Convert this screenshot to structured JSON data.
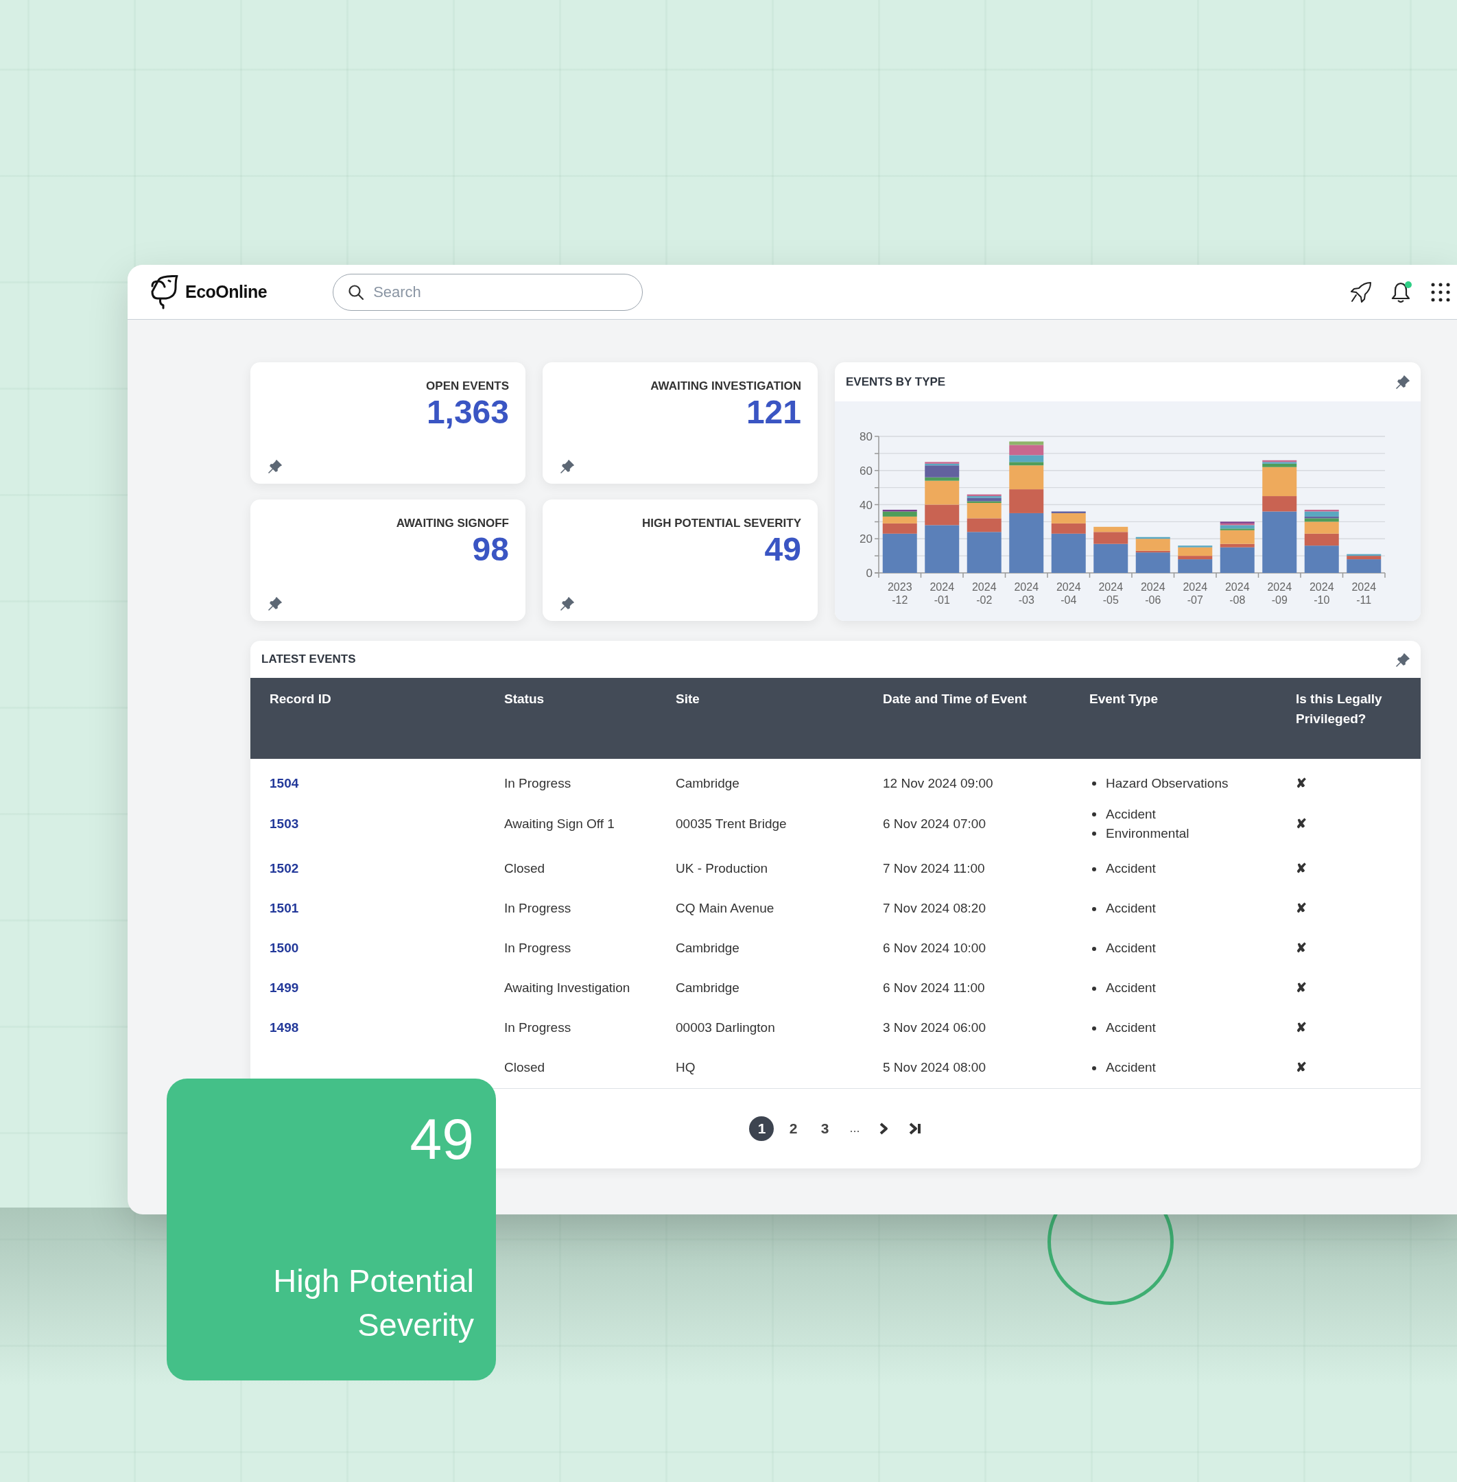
{
  "header": {
    "logo_text": "EcoOnline",
    "search": {
      "placeholder": "Search"
    },
    "has_notifications": true
  },
  "kpis": [
    {
      "title": "OPEN EVENTS",
      "value": "1,363"
    },
    {
      "title": "AWAITING INVESTIGATION",
      "value": "121"
    },
    {
      "title": "AWAITING SIGNOFF",
      "value": "98"
    },
    {
      "title": "HIGH POTENTIAL SEVERITY",
      "value": "49"
    }
  ],
  "events_by_type": {
    "title": "EVENTS BY TYPE",
    "chart_data": {
      "type": "bar",
      "stacked": true,
      "grid": true,
      "categories": [
        "2023-12",
        "2024-01",
        "2024-02",
        "2024-03",
        "2024-04",
        "2024-05",
        "2024-06",
        "2024-07",
        "2024-08",
        "2024-09",
        "2024-10",
        "2024-11"
      ],
      "ylim": [
        0,
        80
      ],
      "yticks": [
        0,
        20,
        40,
        60,
        80
      ],
      "series": [
        {
          "color": "#5b80b9",
          "values": [
            23,
            28,
            24,
            35,
            23,
            17,
            12,
            8,
            15,
            36,
            16,
            8
          ]
        },
        {
          "color": "#c96352",
          "values": [
            6,
            12,
            8,
            14,
            6,
            7,
            1,
            2,
            2,
            9,
            7,
            2
          ]
        },
        {
          "color": "#eeaa5c",
          "values": [
            4,
            14,
            9,
            14,
            6,
            3,
            7,
            5,
            8,
            17,
            7,
            0
          ]
        },
        {
          "color": "#4f9d5a",
          "values": [
            3,
            2,
            1,
            2,
            0,
            0,
            0,
            0,
            1,
            2,
            2,
            0
          ]
        },
        {
          "color": "#62619e",
          "values": [
            0,
            7,
            2,
            0,
            1,
            0,
            0,
            0,
            0,
            0,
            1,
            0
          ]
        },
        {
          "color": "#5aa7c0",
          "values": [
            0,
            1,
            1,
            4,
            0,
            0,
            1,
            1,
            2,
            1,
            3,
            1
          ]
        },
        {
          "color": "#c8688e",
          "values": [
            0,
            1,
            1,
            6,
            0,
            0,
            0,
            0,
            1,
            1,
            1,
            0
          ]
        },
        {
          "color": "#8fb46a",
          "values": [
            0,
            0,
            0,
            2,
            0,
            0,
            0,
            0,
            0,
            0,
            0,
            0
          ]
        },
        {
          "color": "#7d3f8f",
          "values": [
            1,
            0,
            0,
            0,
            0,
            0,
            0,
            0,
            1,
            0,
            0,
            0
          ]
        }
      ]
    }
  },
  "latest_events": {
    "title": "LATEST EVENTS",
    "columns": [
      "Record ID",
      "Status",
      "Site",
      "Date and Time of Event",
      "Event Type",
      "Is this Legally Privileged?"
    ],
    "rows": [
      {
        "record_id": "1504",
        "status": "In Progress",
        "site": "Cambridge",
        "date_time": "12 Nov 2024 09:00",
        "event_types": [
          "Hazard Observations"
        ],
        "legally_privileged": "✘"
      },
      {
        "record_id": "1503",
        "status": "Awaiting Sign Off 1",
        "site": "00035 Trent Bridge",
        "date_time": "6 Nov 2024 07:00",
        "event_types": [
          "Accident",
          "Environmental"
        ],
        "legally_privileged": "✘"
      },
      {
        "record_id": "1502",
        "status": "Closed",
        "site": "UK - Production",
        "date_time": "7 Nov 2024 11:00",
        "event_types": [
          "Accident"
        ],
        "legally_privileged": "✘"
      },
      {
        "record_id": "1501",
        "status": "In Progress",
        "site": "CQ Main Avenue",
        "date_time": "7 Nov 2024 08:20",
        "event_types": [
          "Accident"
        ],
        "legally_privileged": "✘"
      },
      {
        "record_id": "1500",
        "status": "In Progress",
        "site": "Cambridge",
        "date_time": "6 Nov 2024 10:00",
        "event_types": [
          "Accident"
        ],
        "legally_privileged": "✘"
      },
      {
        "record_id": "1499",
        "status": "Awaiting Investigation",
        "site": "Cambridge",
        "date_time": "6 Nov 2024 11:00",
        "event_types": [
          "Accident"
        ],
        "legally_privileged": "✘"
      },
      {
        "record_id": "1498",
        "status": "In Progress",
        "site": "00003 Darlington",
        "date_time": "3 Nov 2024 06:00",
        "event_types": [
          "Accident"
        ],
        "legally_privileged": "✘"
      },
      {
        "status": "Closed",
        "site": "HQ",
        "date_time": "5 Nov 2024 08:00",
        "event_types": [
          "Accident"
        ],
        "legally_privileged": "✘"
      }
    ],
    "pagination": {
      "pages": [
        {
          "label": "1",
          "selected": true
        },
        {
          "label": "2",
          "selected": false
        },
        {
          "label": "3",
          "selected": false
        }
      ],
      "ellipsis": "..."
    }
  },
  "highlight_card": {
    "value": "49",
    "label": "High Potential Severity"
  }
}
